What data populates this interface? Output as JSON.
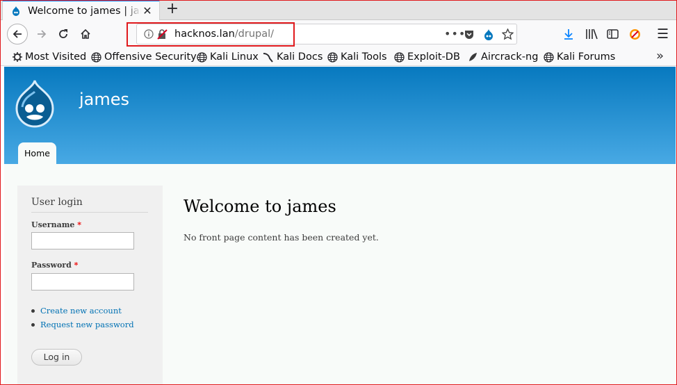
{
  "browser": {
    "tab": {
      "title": "Welcome to james | james",
      "close_icon": "close-icon"
    },
    "url": {
      "host": "hacknos.lan",
      "path": "/drupal/"
    },
    "bookmarks": [
      {
        "label": "Most Visited",
        "icon": "gear-icon"
      },
      {
        "label": "Offensive Security",
        "icon": "globe-icon"
      },
      {
        "label": "Kali Linux",
        "icon": "globe-icon"
      },
      {
        "label": "Kali Docs",
        "icon": "kali-icon"
      },
      {
        "label": "Kali Tools",
        "icon": "globe-icon"
      },
      {
        "label": "Exploit-DB",
        "icon": "globe-icon"
      },
      {
        "label": "Aircrack-ng",
        "icon": "aircrack-icon"
      },
      {
        "label": "Kali Forums",
        "icon": "globe-icon"
      }
    ]
  },
  "site": {
    "name": "james",
    "nav": {
      "home": "Home"
    },
    "login": {
      "title": "User login",
      "username_label": "Username",
      "password_label": "Password",
      "required_mark": "*",
      "create_account": "Create new account",
      "request_password": "Request new password",
      "submit": "Log in"
    },
    "main": {
      "title": "Welcome to james",
      "text": "No front page content has been created yet."
    }
  },
  "colors": {
    "accent": "#0a84ff",
    "highlight": "#e0191c",
    "header_top": "#0779bf",
    "header_bottom": "#48a9e4",
    "link": "#0071b3"
  }
}
